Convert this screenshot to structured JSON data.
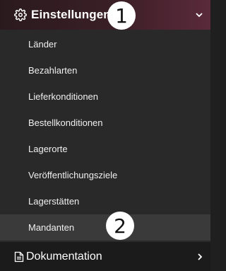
{
  "header": {
    "icon": "gear-icon",
    "label": "Einstellungen",
    "chevron": "chevron-down-icon"
  },
  "submenu": {
    "items": [
      {
        "label": "Länder"
      },
      {
        "label": "Bezahlarten"
      },
      {
        "label": "Lieferkonditionen"
      },
      {
        "label": "Bestellkonditionen"
      },
      {
        "label": "Lagerorte"
      },
      {
        "label": "Veröffentlichungsziele"
      },
      {
        "label": "Lagerstätten"
      },
      {
        "label": "Mandanten",
        "active": true
      }
    ]
  },
  "footer": {
    "icon": "document-icon",
    "label": "Dokumentation",
    "chevron": "chevron-right-icon"
  },
  "annotations": {
    "badge1": "1",
    "badge2": "2"
  }
}
